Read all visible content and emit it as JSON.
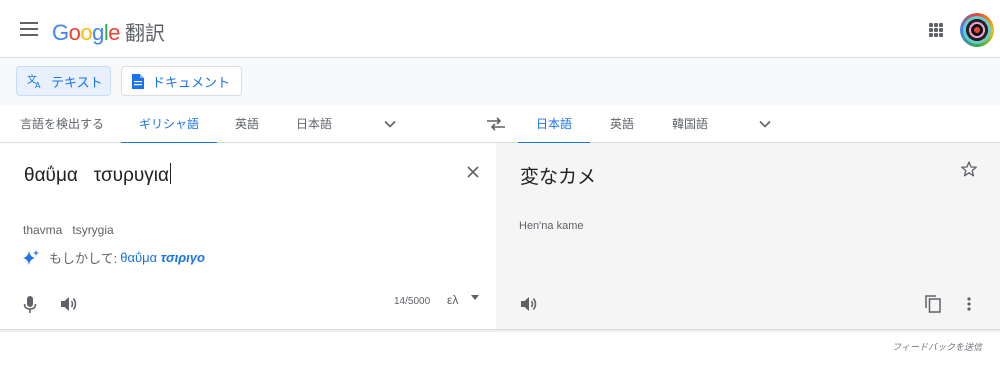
{
  "header": {
    "logo_chars": [
      {
        "ch": "G",
        "color": "#4285f4"
      },
      {
        "ch": "o",
        "color": "#ea4335"
      },
      {
        "ch": "o",
        "color": "#fbbc05"
      },
      {
        "ch": "g",
        "color": "#4285f4"
      },
      {
        "ch": "l",
        "color": "#34a853"
      },
      {
        "ch": "e",
        "color": "#ea4335"
      }
    ],
    "product_name": "翻訳",
    "menu_icon": "hamburger-menu-icon",
    "apps_icon": "apps-grid-icon"
  },
  "modes": {
    "text_label": "テキスト",
    "documents_label": "ドキュメント"
  },
  "source_langs": {
    "detect": "言語を検出する",
    "greek": "ギリシャ語",
    "english": "英語",
    "japanese": "日本語"
  },
  "target_langs": {
    "japanese": "日本語",
    "english": "英語",
    "korean": "韓国語"
  },
  "source": {
    "text": "θαΰμα   τσυρυγια",
    "transliteration": "thavma   tsyrygia",
    "suggestion_prefix": "もしかして:",
    "suggestion_plain": "θαΰμα",
    "suggestion_bold": "τσιριγο",
    "char_count": "14/5000",
    "ime_label": "ελ"
  },
  "target": {
    "text": "変なカメ",
    "transliteration": "Hen'na kame"
  },
  "footer": {
    "feedback": "フィードバックを送信"
  },
  "colors": {
    "accent": "#1a73e8",
    "target_bg": "#f5f5f5",
    "mode_bg": "#f8f9fa"
  }
}
